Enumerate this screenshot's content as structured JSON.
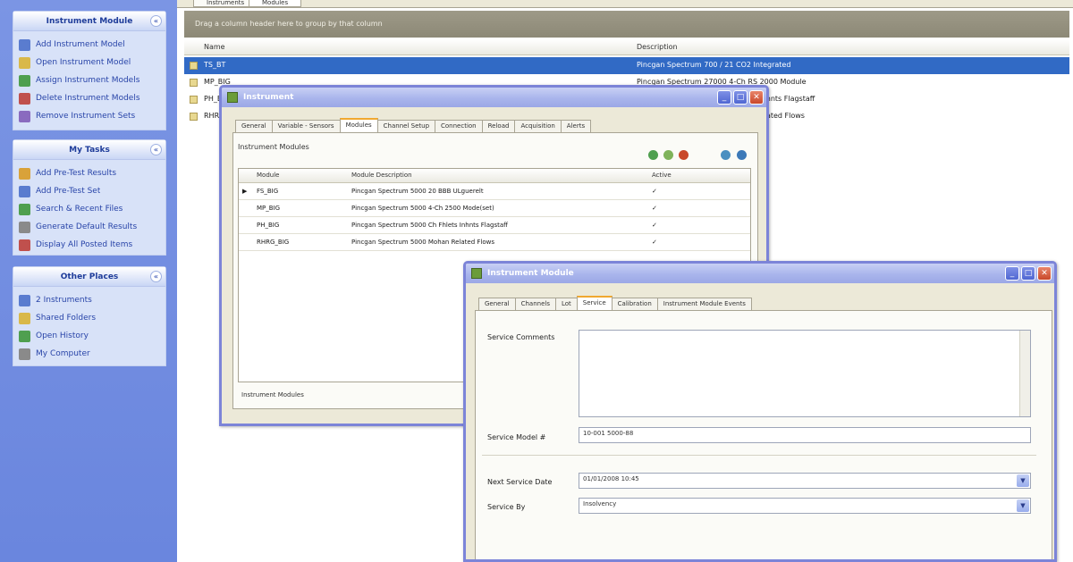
{
  "sidebar": {
    "panels": [
      {
        "title": "Instrument Module",
        "items": [
          {
            "label": "Add Instrument Model",
            "icon": "instrument-add-icon",
            "color": "#5a7ccf"
          },
          {
            "label": "Open Instrument Model",
            "icon": "folder-open-icon",
            "color": "#d9b84a"
          },
          {
            "label": "Assign Instrument Models",
            "icon": "assign-icon",
            "color": "#4f9f4f"
          },
          {
            "label": "Delete Instrument Models",
            "icon": "delete-icon",
            "color": "#c0504d"
          },
          {
            "label": "Remove Instrument Sets",
            "icon": "remove-icon",
            "color": "#8a6bbf"
          }
        ]
      },
      {
        "title": "My Tasks",
        "items": [
          {
            "label": "Add Pre-Test Results",
            "icon": "pretest-icon",
            "color": "#d9a23a"
          },
          {
            "label": "Add Pre-Test Set",
            "icon": "test-set-icon",
            "color": "#5a7ccf"
          },
          {
            "label": "Search & Recent Files",
            "icon": "search-icon",
            "color": "#4f9f4f"
          },
          {
            "label": "Generate Default Results",
            "icon": "generate-icon",
            "color": "#8a8a8a"
          },
          {
            "label": "Display All Posted Items",
            "icon": "display-icon",
            "color": "#c0504d"
          }
        ]
      },
      {
        "title": "Other Places",
        "items": [
          {
            "label": "2 Instruments",
            "icon": "instruments-icon",
            "color": "#5a7ccf"
          },
          {
            "label": "Shared Folders",
            "icon": "shared-folder-icon",
            "color": "#d9b84a"
          },
          {
            "label": "Open History",
            "icon": "history-icon",
            "color": "#4f9f4f"
          },
          {
            "label": "My Computer",
            "icon": "computer-icon",
            "color": "#8a8a8a"
          }
        ]
      }
    ]
  },
  "main": {
    "top_tabs": [
      "Instruments",
      "Modules"
    ],
    "group_bar": "Drag a column header here to group by that column",
    "columns": [
      "Name",
      "Description"
    ],
    "rows": [
      {
        "name": "TS_BT",
        "description": "Pincgan Spectrum 700 / 21 CO2 Integrated",
        "selected": true
      },
      {
        "name": "MP_BIG",
        "description": "Pincgan Spectrum 27000 4-Ch RS 2000 Module",
        "selected": false
      },
      {
        "name": "PH_BIG",
        "description": "Pincgan Spectrum 18000 Dual Ch Inhnts Flagstaff",
        "selected": false
      },
      {
        "name": "RHRG_BIG",
        "description": "Pincgan Spectrum 18000 Mohan Related Flows",
        "selected": false
      }
    ]
  },
  "dialog1": {
    "title": "Instrument",
    "tabs": [
      "General",
      "Variable - Sensors",
      "Modules",
      "Channel Setup",
      "Connection",
      "Reload",
      "Acquisition",
      "Alerts"
    ],
    "active_tab": 2,
    "group_label": "Instrument Modules",
    "columns": [
      "Module",
      "Module Description",
      "Active"
    ],
    "rows": [
      {
        "module": "FS_BIG",
        "description": "Pincgan Spectrum 5000 20 BBB ULguerelt",
        "active": "✓"
      },
      {
        "module": "MP_BIG",
        "description": "Pincgan Spectrum 5000 4-Ch 2500 Mode(set)",
        "active": "✓"
      },
      {
        "module": "PH_BIG",
        "description": "Pincgan Spectrum 5000 Ch Fhlets Inhnts Flagstaff",
        "active": "✓"
      },
      {
        "module": "RHRG_BIG",
        "description": "Pincgan Spectrum 5000 Mohan Related Flows",
        "active": "✓"
      }
    ],
    "status": "Instrument Modules"
  },
  "dialog2": {
    "title": "Instrument Module",
    "tabs": [
      "General",
      "Channels",
      "Lot",
      "Service",
      "Calibration",
      "Instrument Module Events"
    ],
    "active_tab": 3,
    "comments_label": "Service Comments",
    "comments_value": "",
    "model_label": "Service Model #",
    "model_value": "10-001 5000-88",
    "date_label": "Next Service Date",
    "date_value": "01/01/2008 10:45",
    "by_label": "Service By",
    "by_value": "Insolvency"
  },
  "colors": {
    "sidebar_bg": "#6a86de",
    "selection": "#316ac5",
    "dialog_border": "#7c84d8",
    "active_tab_accent": "#f0a830"
  }
}
